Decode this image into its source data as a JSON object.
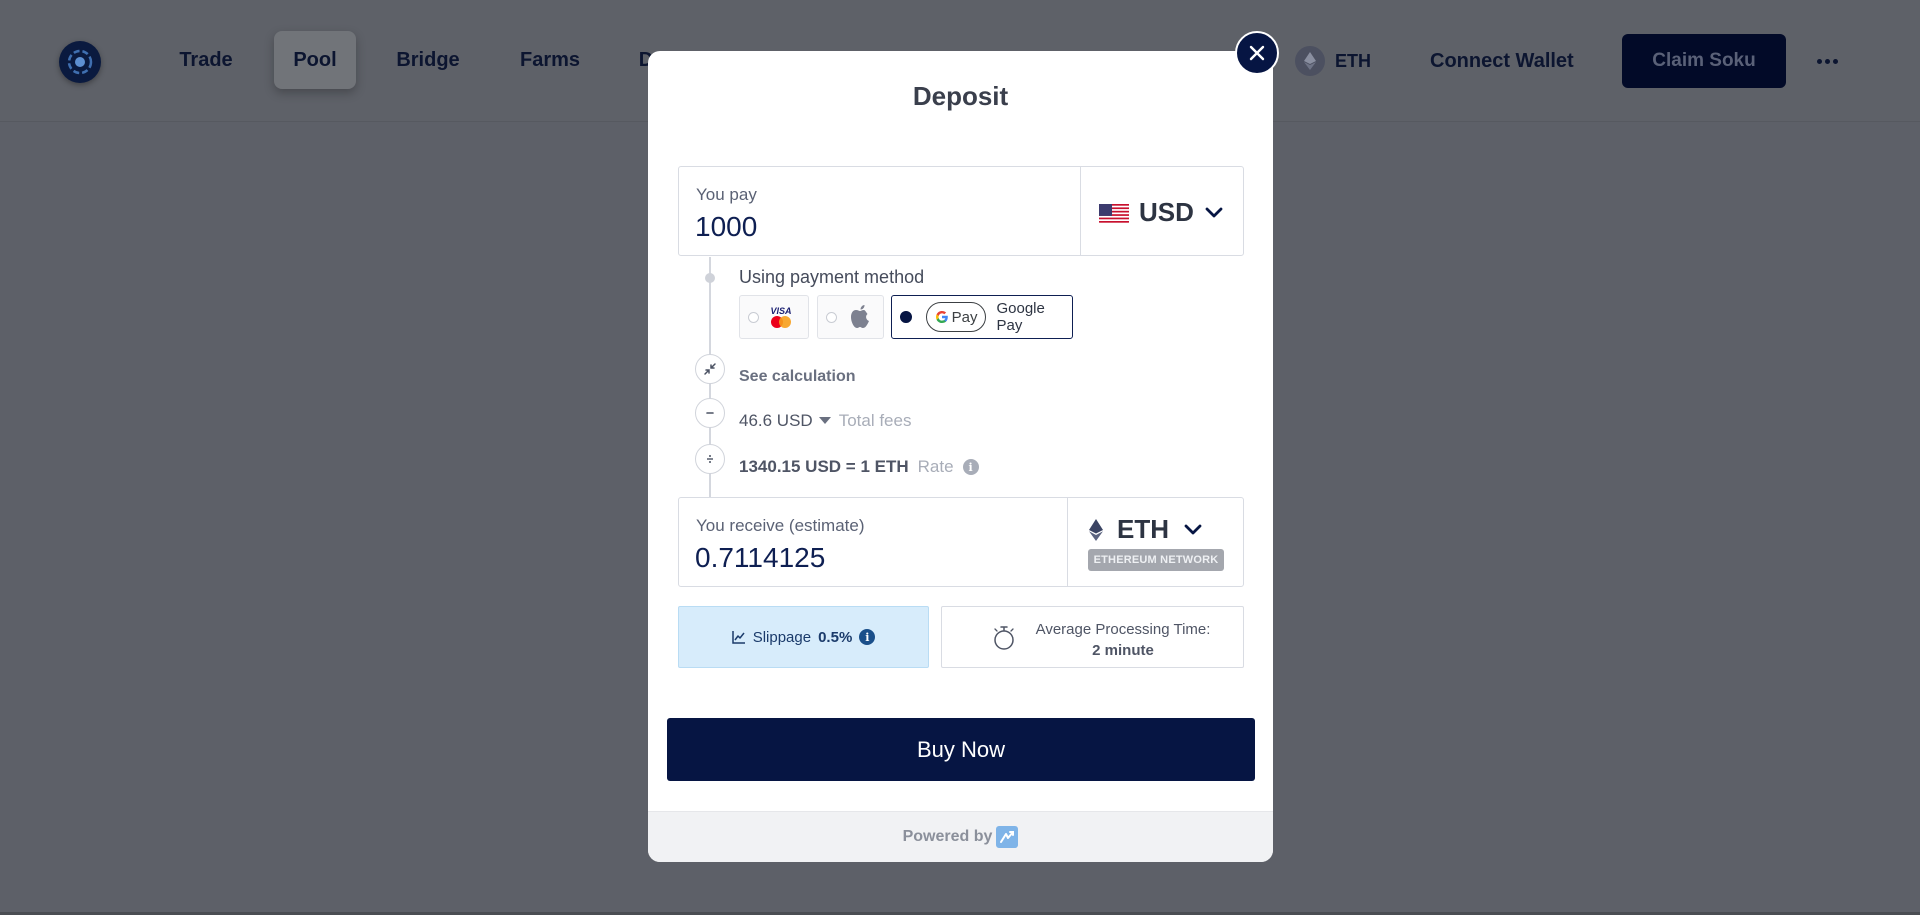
{
  "nav": {
    "items": [
      {
        "label": "Trade"
      },
      {
        "label": "Pool"
      },
      {
        "label": "Bridge"
      },
      {
        "label": "Farms"
      },
      {
        "label": "D"
      }
    ],
    "network_label": "ETH",
    "connect_label": "Connect Wallet",
    "claim_label": "Claim Soku"
  },
  "modal": {
    "title": "Deposit",
    "pay": {
      "label": "You pay",
      "value": "1000",
      "currency": "USD"
    },
    "payment": {
      "label": "Using payment method",
      "options": [
        {
          "icon": "visa-mastercard-icon",
          "selected": false
        },
        {
          "icon": "apple-icon",
          "selected": false
        },
        {
          "icon": "google-pay-icon",
          "selected": true,
          "label": "Google Pay",
          "pill": "Pay"
        }
      ]
    },
    "calculation": {
      "toggle_label": "See calculation",
      "fees_value": "46.6 USD",
      "fees_label": "Total fees",
      "rate_value": "1340.15 USD = 1 ETH",
      "rate_label": "Rate"
    },
    "receive": {
      "label": "You receive (estimate)",
      "value": "0.7114125",
      "currency": "ETH",
      "network": "ETHEREUM NETWORK"
    },
    "slippage": {
      "label": "Slippage",
      "value": "0.5%"
    },
    "processing": {
      "label": "Average Processing Time:",
      "value": "2 minute"
    },
    "buy_label": "Buy Now",
    "footer": "Powered by"
  },
  "colors": {
    "primary": "#061543",
    "overlay": "#5d6068",
    "slippage_bg": "#d7ecfb"
  }
}
